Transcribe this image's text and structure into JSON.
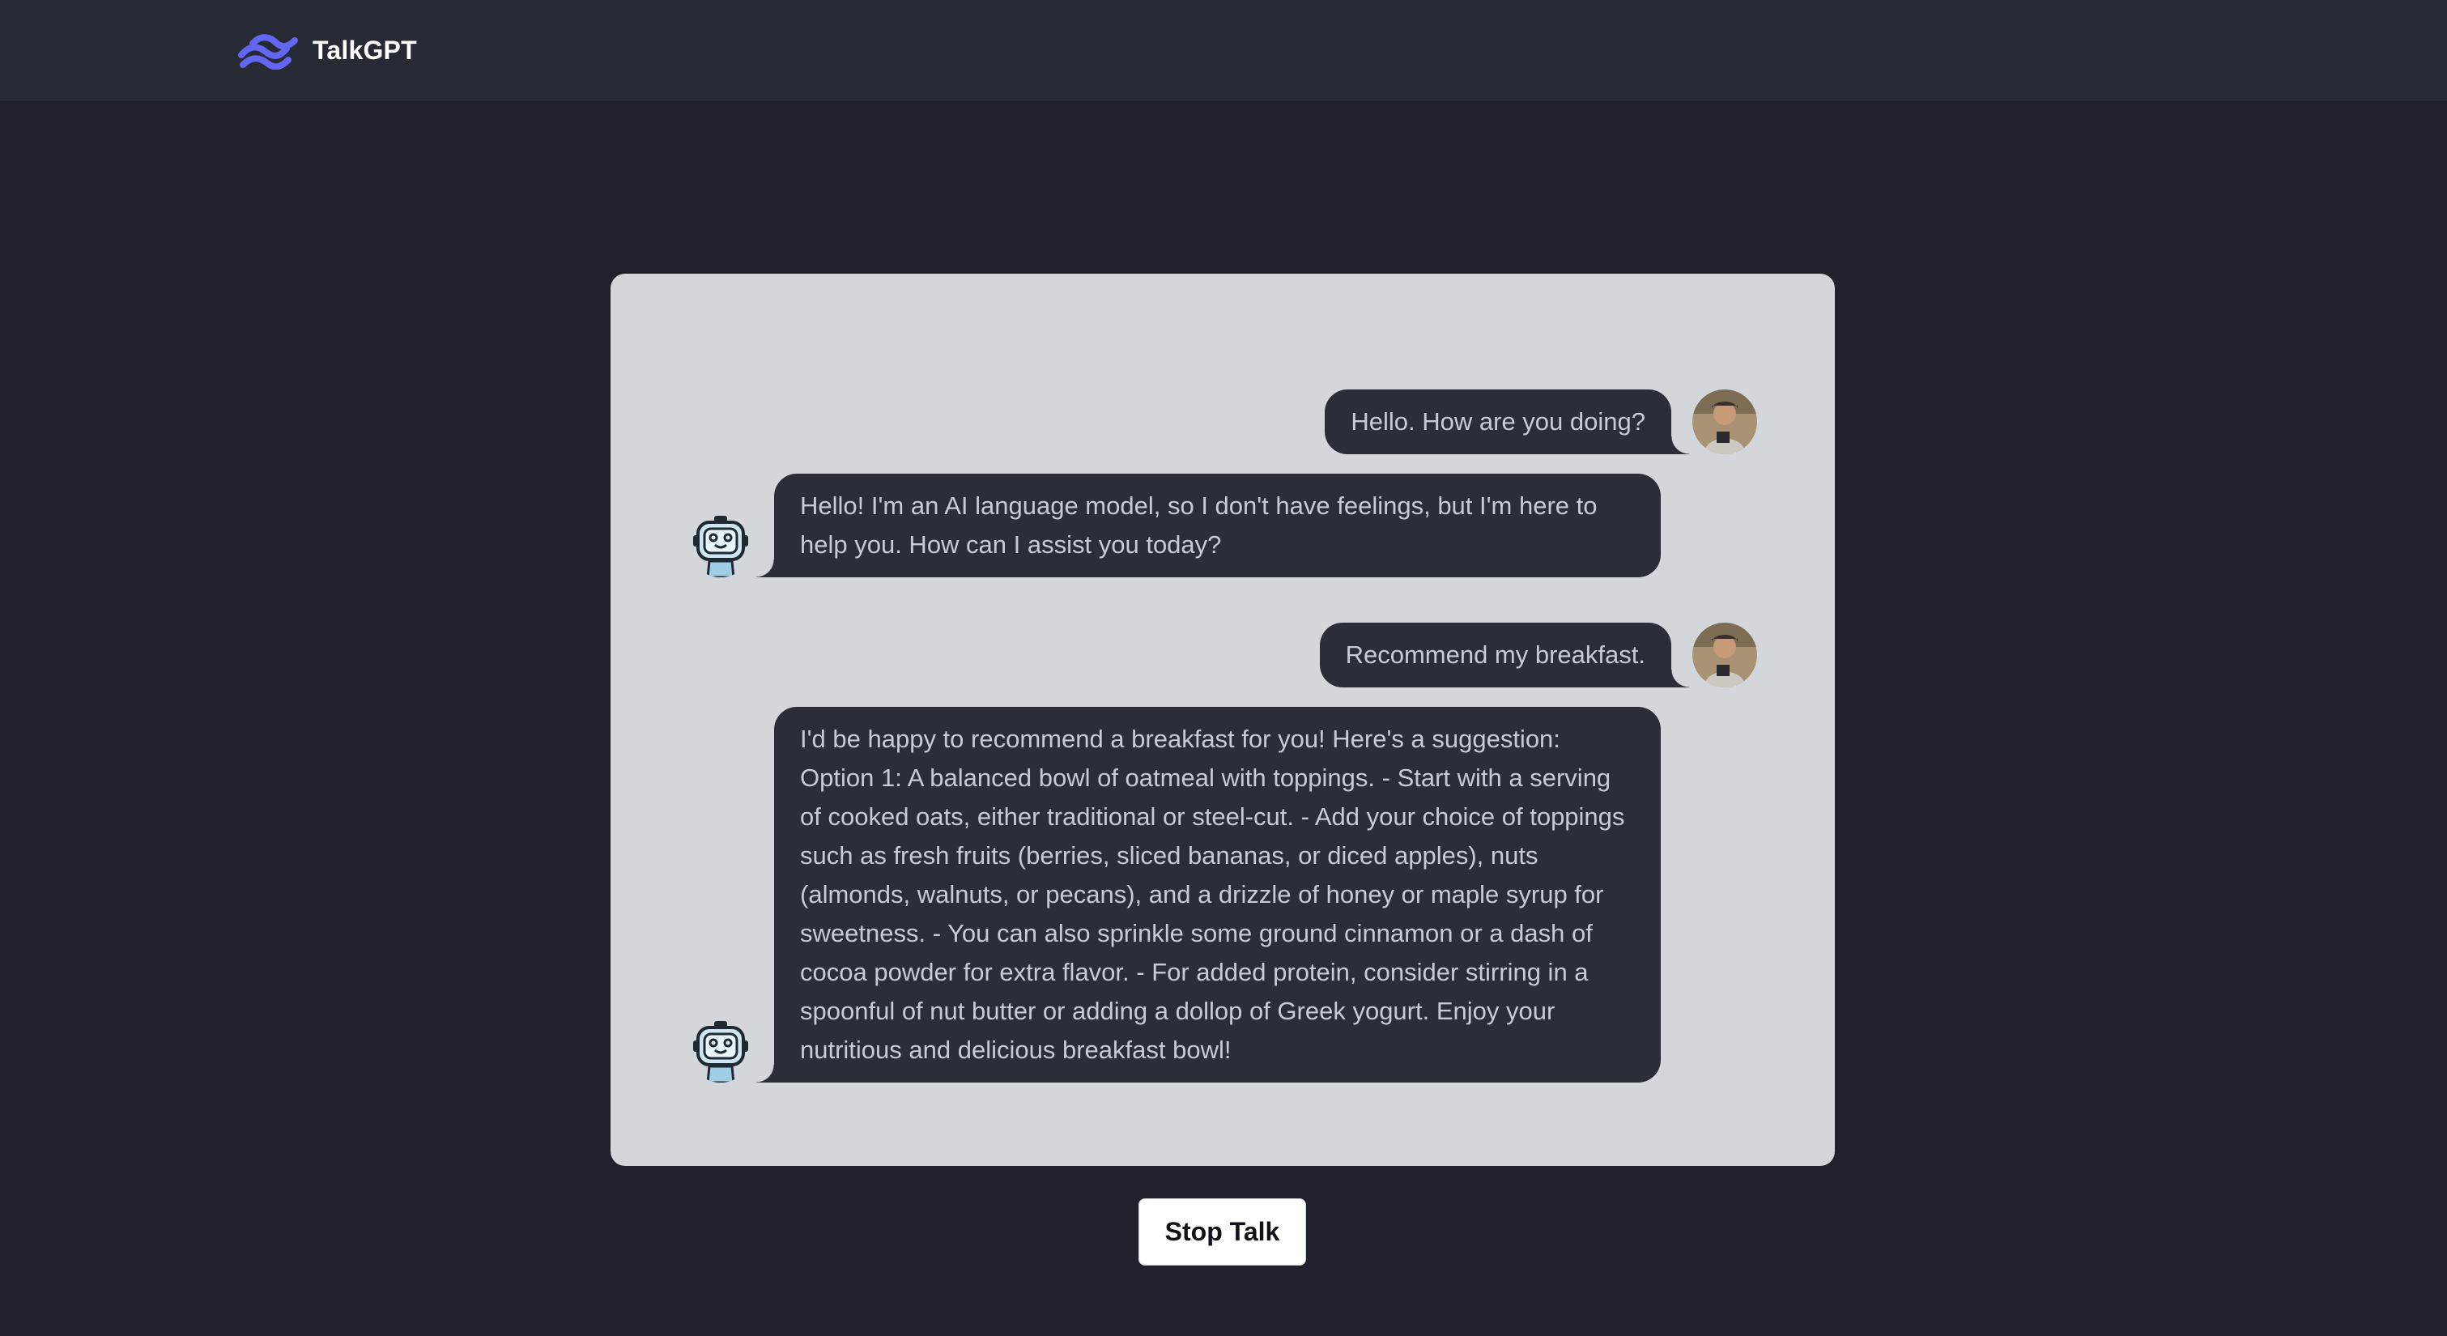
{
  "app": {
    "name": "TalkGPT",
    "accent_color": "#6366f1"
  },
  "chat": {
    "messages": [
      {
        "role": "user",
        "text": "Hello. How are you doing?",
        "avatar": "user-photo"
      },
      {
        "role": "assistant",
        "text": "Hello! I'm an AI language model, so I don't have feelings, but I'm here to help you. How can I assist you today?",
        "avatar": "robot-icon"
      },
      {
        "role": "user",
        "text": "Recommend my breakfast.",
        "avatar": "user-photo"
      },
      {
        "role": "assistant",
        "text": "I'd be happy to recommend a breakfast for you! Here's a suggestion: Option 1: A balanced bowl of oatmeal with toppings. - Start with a serving of cooked oats, either traditional or steel-cut. - Add your choice of toppings such as fresh fruits (berries, sliced bananas, or diced apples), nuts (almonds, walnuts, or pecans), and a drizzle of honey or maple syrup for sweetness. - You can also sprinkle some ground cinnamon or a dash of cocoa powder for extra flavor. - For added protein, consider stirring in a spoonful of nut butter or adding a dollop of Greek yogurt. Enjoy your nutritious and delicious breakfast bowl!",
        "avatar": "robot-icon"
      }
    ]
  },
  "controls": {
    "stop_label": "Stop Talk"
  }
}
